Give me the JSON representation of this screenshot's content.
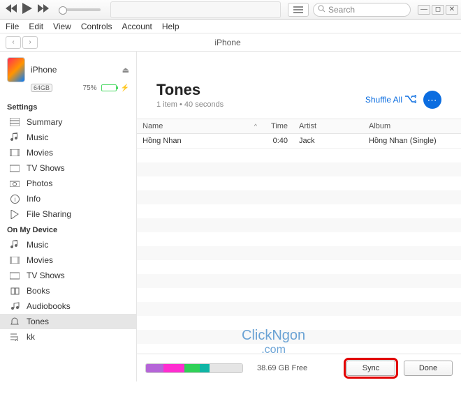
{
  "search": {
    "placeholder": "Search"
  },
  "menubar": [
    "File",
    "Edit",
    "View",
    "Controls",
    "Account",
    "Help"
  ],
  "nav": {
    "title": "iPhone"
  },
  "device": {
    "name": "iPhone",
    "capacity": "64GB",
    "battery_pct": "75%"
  },
  "sidebar": {
    "settings_header": "Settings",
    "settings": [
      {
        "label": "Summary",
        "ico": "list"
      },
      {
        "label": "Music",
        "ico": "music"
      },
      {
        "label": "Movies",
        "ico": "film"
      },
      {
        "label": "TV Shows",
        "ico": "tv"
      },
      {
        "label": "Photos",
        "ico": "camera"
      },
      {
        "label": "Info",
        "ico": "info"
      },
      {
        "label": "File Sharing",
        "ico": "share"
      }
    ],
    "ondevice_header": "On My Device",
    "ondevice": [
      {
        "label": "Music",
        "ico": "music"
      },
      {
        "label": "Movies",
        "ico": "film"
      },
      {
        "label": "TV Shows",
        "ico": "tv"
      },
      {
        "label": "Books",
        "ico": "book"
      },
      {
        "label": "Audiobooks",
        "ico": "audio"
      },
      {
        "label": "Tones",
        "ico": "bell",
        "sel": true
      },
      {
        "label": "kk",
        "ico": "pl"
      }
    ]
  },
  "main": {
    "title": "Tones",
    "subtitle": "1 item • 40 seconds",
    "shuffle": "Shuffle All",
    "columns": {
      "name": "Name",
      "time": "Time",
      "artist": "Artist",
      "album": "Album"
    },
    "rows": [
      {
        "name": "Hồng Nhan",
        "time": "0:40",
        "artist": "Jack",
        "album": "Hồng Nhan (Single)"
      }
    ]
  },
  "footer": {
    "free": "38.69 GB Free",
    "sync": "Sync",
    "done": "Done",
    "segments": [
      {
        "color": "#b565d8",
        "w": "18%"
      },
      {
        "color": "#ff2dd0",
        "w": "22%"
      },
      {
        "color": "#30d158",
        "w": "16%"
      },
      {
        "color": "#0fb5a5",
        "w": "10%"
      },
      {
        "color": "#e5e5e5",
        "w": "34%"
      }
    ]
  },
  "watermark": {
    "l1": "ClickNgon",
    "l2": ".com"
  }
}
